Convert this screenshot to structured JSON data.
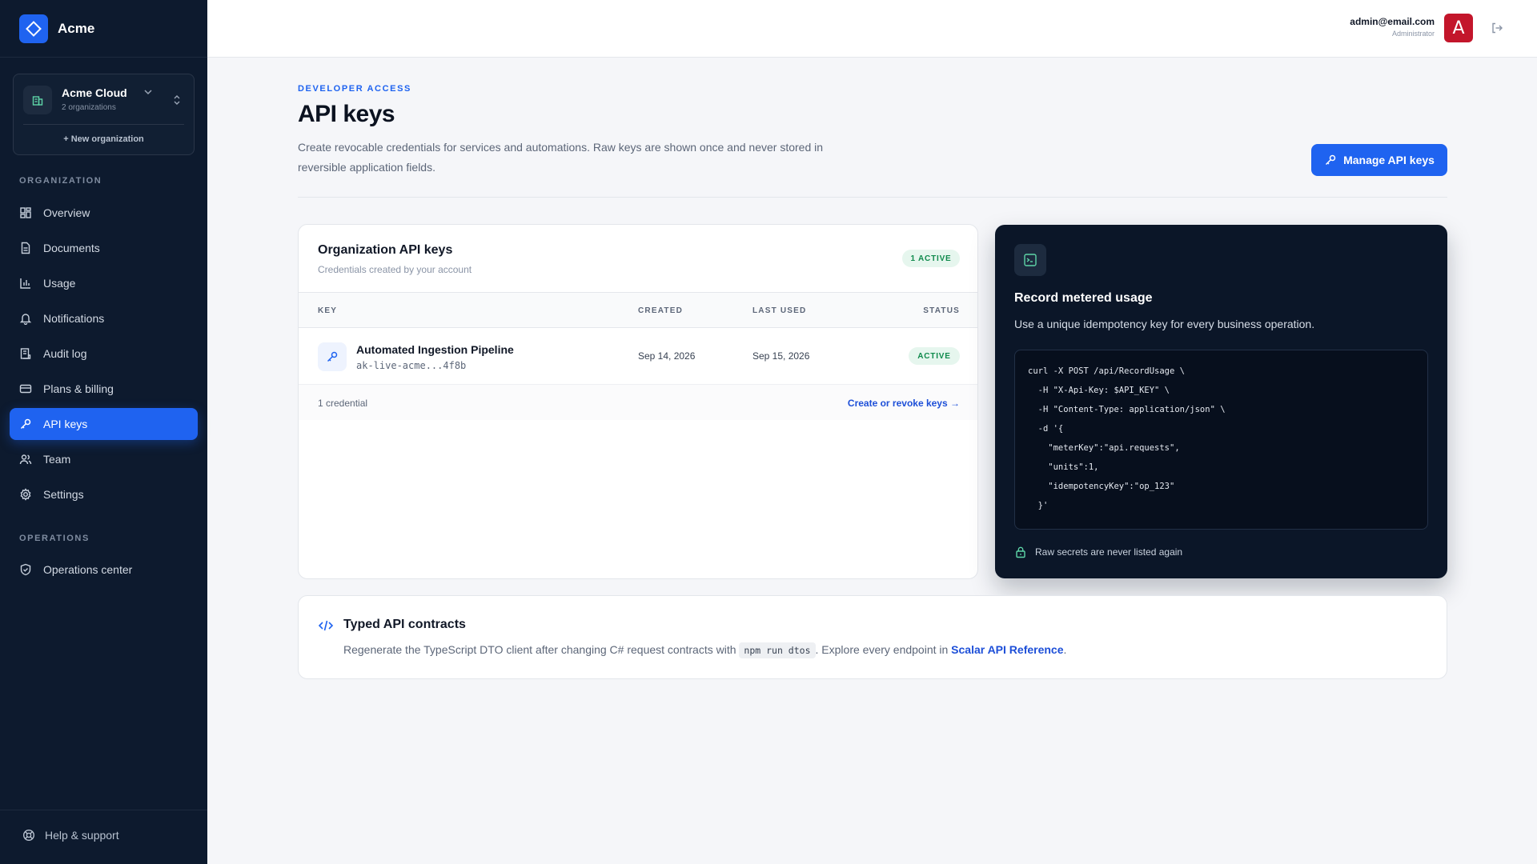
{
  "brand": {
    "name": "Acme"
  },
  "org": {
    "name": "Acme Cloud",
    "count": "2 organizations",
    "new_label": "+ New organization"
  },
  "sidebar": {
    "section_org": "ORGANIZATION",
    "section_ops": "OPERATIONS",
    "items": [
      {
        "label": "Overview",
        "icon": "grid-icon"
      },
      {
        "label": "Documents",
        "icon": "document-icon"
      },
      {
        "label": "Usage",
        "icon": "bar-chart-icon"
      },
      {
        "label": "Notifications",
        "icon": "bell-icon"
      },
      {
        "label": "Audit log",
        "icon": "audit-log-icon"
      },
      {
        "label": "Plans & billing",
        "icon": "credit-card-icon"
      },
      {
        "label": "API keys",
        "icon": "key-icon",
        "active": true
      },
      {
        "label": "Team",
        "icon": "users-icon"
      },
      {
        "label": "Settings",
        "icon": "gear-icon"
      }
    ],
    "ops_items": [
      {
        "label": "Operations center",
        "icon": "shield-icon"
      }
    ],
    "help_label": "Help & support"
  },
  "user": {
    "email": "admin@email.com",
    "role": "Administrator",
    "avatar_letter": "A"
  },
  "header": {
    "eyebrow": "DEVELOPER ACCESS",
    "title": "API keys",
    "description": "Create revocable credentials for services and automations. Raw keys are shown once and never stored in reversible application fields.",
    "manage_button": "Manage API keys"
  },
  "keys_card": {
    "title": "Organization API keys",
    "subtitle": "Credentials created by your account",
    "active_badge": "1 ACTIVE",
    "columns": {
      "key": "KEY",
      "created": "CREATED",
      "last_used": "LAST USED",
      "status": "STATUS"
    },
    "rows": [
      {
        "name": "Automated Ingestion Pipeline",
        "prefix": "ak-live-acme...4f8b",
        "created": "Sep 14, 2026",
        "last_used": "Sep 15, 2026",
        "status": "ACTIVE"
      }
    ],
    "footer_count": "1 credential",
    "footer_link": "Create or revoke keys →"
  },
  "usage_card": {
    "title": "Record metered usage",
    "description": "Use a unique idempotency key for every business operation.",
    "code": "curl -X POST /api/RecordUsage \\\n  -H \"X-Api-Key: $API_KEY\" \\\n  -H \"Content-Type: application/json\" \\\n  -d '{\n    \"meterKey\":\"api.requests\",\n    \"units\":1,\n    \"idempotencyKey\":\"op_123\"\n  }'",
    "note": "Raw secrets are never listed again"
  },
  "contracts": {
    "title": "Typed API contracts",
    "text_before": "Regenerate the TypeScript DTO client after changing C# request contracts with ",
    "command": "npm run dtos",
    "text_middle": ". Explore every endpoint in ",
    "link": "Scalar API Reference",
    "text_after": "."
  },
  "colors": {
    "accent": "#1f63f0",
    "sidebar_bg": "#0d1a2e",
    "success": "#0f8a4c",
    "avatar": "#c3162b"
  }
}
